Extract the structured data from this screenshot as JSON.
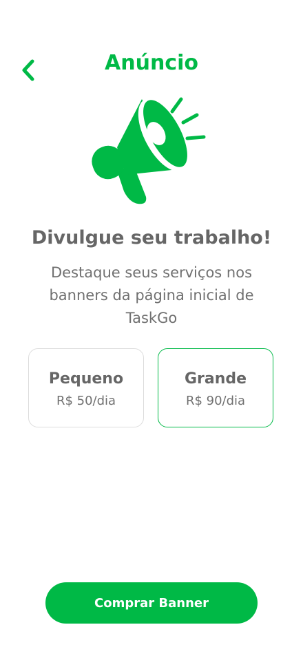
{
  "colors": {
    "accent": "#00b946",
    "text_gray": "#666666",
    "border_light": "#dcdcdc",
    "button_text": "#ffffff"
  },
  "header": {
    "back_icon": "chevron-left-icon",
    "title": "Anúncio"
  },
  "hero": {
    "icon": "megaphone-icon"
  },
  "content": {
    "headline": "Divulgue seu trabalho!",
    "description": "Destaque seus serviços nos banners da página inicial de TaskGo"
  },
  "plans": [
    {
      "name": "Pequeno",
      "price": "R$ 50/dia",
      "selected": false
    },
    {
      "name": "Grande",
      "price": "R$ 90/dia",
      "selected": true
    }
  ],
  "footer": {
    "buy_label": "Comprar Banner"
  }
}
